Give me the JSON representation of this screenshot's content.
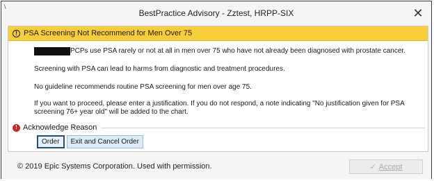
{
  "window": {
    "title": "BestPractice Advisory - Zztest, HRPP-SIX",
    "corner_mark": "\\",
    "close_glyph": "✕"
  },
  "advisory": {
    "header": "PSA Screening Not Recommend for Men Over 75",
    "header_color": "#f7ce3a",
    "paragraph1": "PCPs use PSA rarely or not at all in men over 75 who have not already been diagnosed with prostate cancer.",
    "paragraph2": "Screening with PSA can lead to harms from diagnostic and treatment procedures.",
    "paragraph3": "No guideline recommends routine PSA screening for men over age 75.",
    "paragraph4": "If you want to proceed, please enter a justification. If you do not respond, a note indicating \"No justification given for PSA screening 76+ year old\" will be added to the chart."
  },
  "acknowledge": {
    "label": "Acknowledge Reason",
    "buttons": [
      {
        "label": "Order",
        "selected": true
      },
      {
        "label": "Exit and Cancel Order",
        "selected": false
      }
    ]
  },
  "footer": {
    "copyright": "© 2019 Epic Systems Corporation. Used with permission.",
    "accept_label": "Accept",
    "accept_enabled": false
  },
  "icons": {
    "alert": "alert-circle-icon",
    "required": "required-error-icon",
    "close": "close-icon",
    "check": "checkmark-icon"
  }
}
